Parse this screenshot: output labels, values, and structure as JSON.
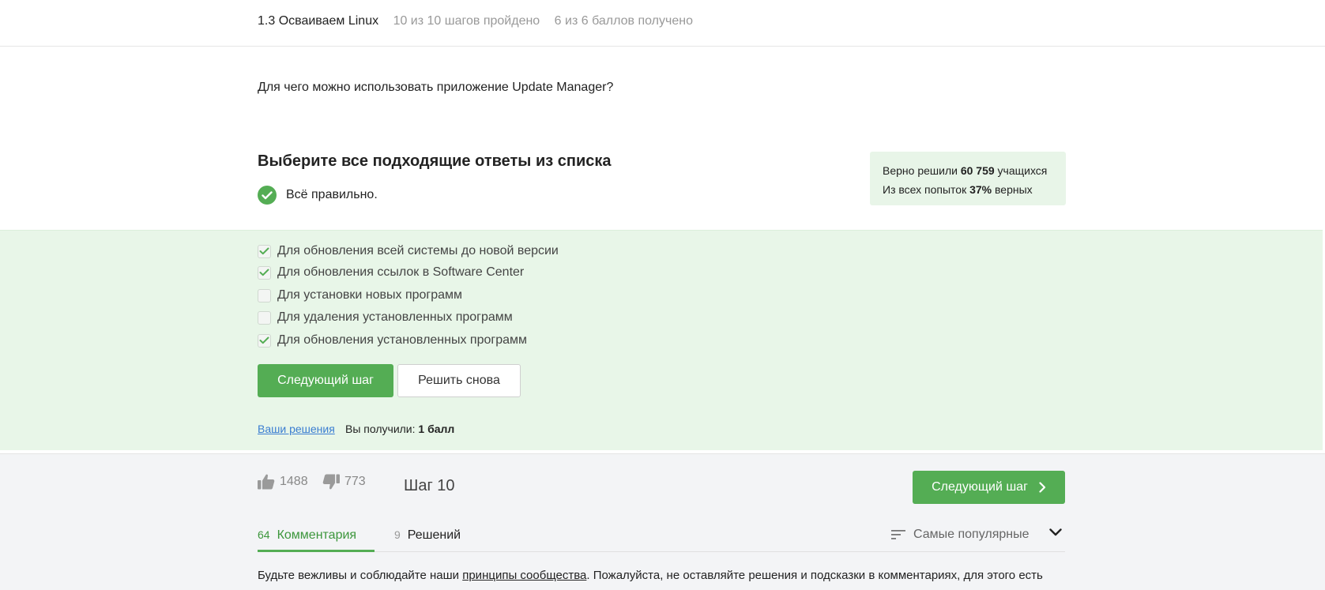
{
  "header": {
    "lesson_title": "1.3 Осваиваем Linux",
    "steps_progress": "10 из 10 шагов пройдено",
    "score_progress": "6 из 6 баллов  получено"
  },
  "question": {
    "text": "Для чего можно использовать приложение Update Manager?"
  },
  "quiz": {
    "instruction": "Выберите все подходящие ответы из списка",
    "result_text": "Всё правильно.",
    "options": [
      {
        "label": "Для обновления всей системы до новой версии",
        "checked": true
      },
      {
        "label": "Для обновления ссылок в Software Center",
        "checked": true
      },
      {
        "label": "Для установки новых программ",
        "checked": false
      },
      {
        "label": "Для удаления установленных программ",
        "checked": false
      },
      {
        "label": "Для обновления установленных программ",
        "checked": true
      }
    ],
    "next_button": "Следующий шаг",
    "retry_button": "Решить снова",
    "solutions_link": "Ваши решения",
    "score_prefix": "Вы получили:",
    "score_value": "1 балл"
  },
  "stats": {
    "solved_prefix": "Верно решили",
    "solved_count": "60 759",
    "solved_suffix": "учащихся",
    "attempts_prefix": "Из всех попыток",
    "attempts_percent": "37%",
    "attempts_suffix": "верных"
  },
  "footer": {
    "likes": "1488",
    "dislikes": "773",
    "step_label": "Шаг 10",
    "next_button": "Следующий шаг",
    "tabs": [
      {
        "count": "64",
        "label": "Комментария",
        "active": true
      },
      {
        "count": "9",
        "label": "Решений",
        "active": false
      }
    ],
    "sort_label": "Самые популярные",
    "rules_before": "Будьте вежливы и соблюдайте наши ",
    "rules_link": "принципы сообщества",
    "rules_after": ". Пожалуйста, не оставляйте решения и подсказки в комментариях, для этого есть"
  },
  "colors": {
    "accent_green": "#54ad54",
    "answers_bg": "#e8f6e8",
    "link_blue": "#3a7dd1"
  },
  "icons": [
    "check-circle-icon",
    "checkbox-check-icon",
    "thumbs-up-icon",
    "thumbs-down-icon",
    "chevron-right-icon",
    "sort-lines-icon",
    "chevron-down-icon"
  ]
}
